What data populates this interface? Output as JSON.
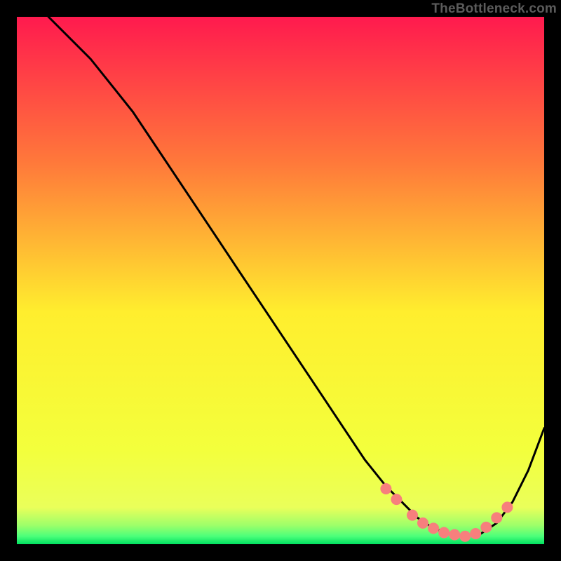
{
  "attribution": "TheBottleneck.com",
  "colors": {
    "top": "#ff1a4e",
    "upper_mid": "#ff7a3a",
    "mid": "#ffee2e",
    "lower_mid": "#f3ff3c",
    "bottom_band": "#4cff7a",
    "bottom_edge": "#00e060",
    "line": "#000000",
    "marker": "#f77f7d",
    "background": "#000000"
  },
  "chart_data": {
    "type": "line",
    "title": "",
    "subtitle": "",
    "xlabel": "",
    "ylabel": "",
    "xlim": [
      0,
      100
    ],
    "ylim": [
      0,
      100
    ],
    "legend": false,
    "grid": false,
    "series": [
      {
        "name": "bottleneck-curve",
        "x": [
          6,
          10,
          14,
          18,
          22,
          26,
          30,
          34,
          38,
          42,
          46,
          50,
          54,
          58,
          62,
          66,
          70,
          73,
          76,
          79,
          82,
          85,
          88,
          91,
          94,
          97,
          100
        ],
        "values": [
          100,
          96,
          92,
          87,
          82,
          76,
          70,
          64,
          58,
          52,
          46,
          40,
          34,
          28,
          22,
          16,
          11,
          8,
          5,
          3,
          2,
          1.5,
          2,
          4,
          8,
          14,
          22
        ]
      }
    ],
    "markers": {
      "name": "highlighted-range",
      "x": [
        70,
        72,
        75,
        77,
        79,
        81,
        83,
        85,
        87,
        89,
        91,
        93
      ],
      "values": [
        10.5,
        8.5,
        5.5,
        4,
        3,
        2.2,
        1.8,
        1.5,
        2,
        3.2,
        5,
        7
      ]
    }
  }
}
